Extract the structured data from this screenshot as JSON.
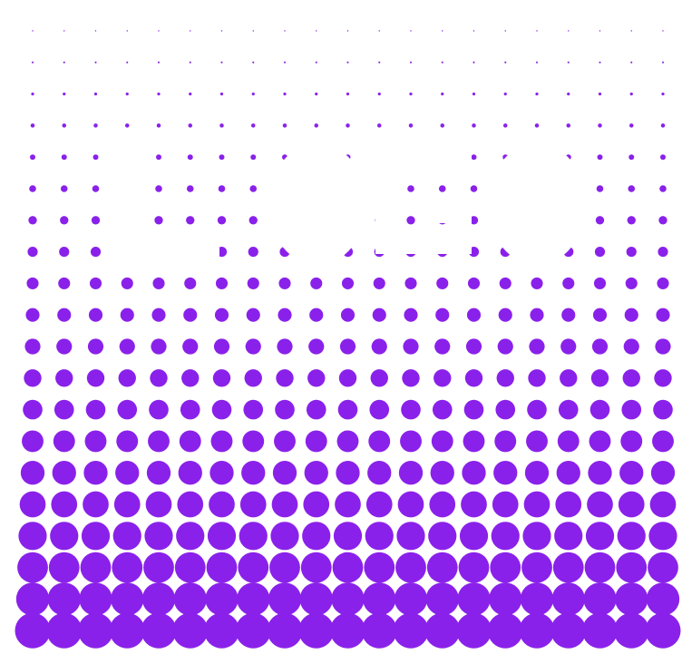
{
  "artwork": {
    "kind": "halftone dot pattern",
    "colors": {
      "dot": "#8a21ea",
      "background": "#ffffff"
    },
    "embedded_text": "LOGO"
  }
}
